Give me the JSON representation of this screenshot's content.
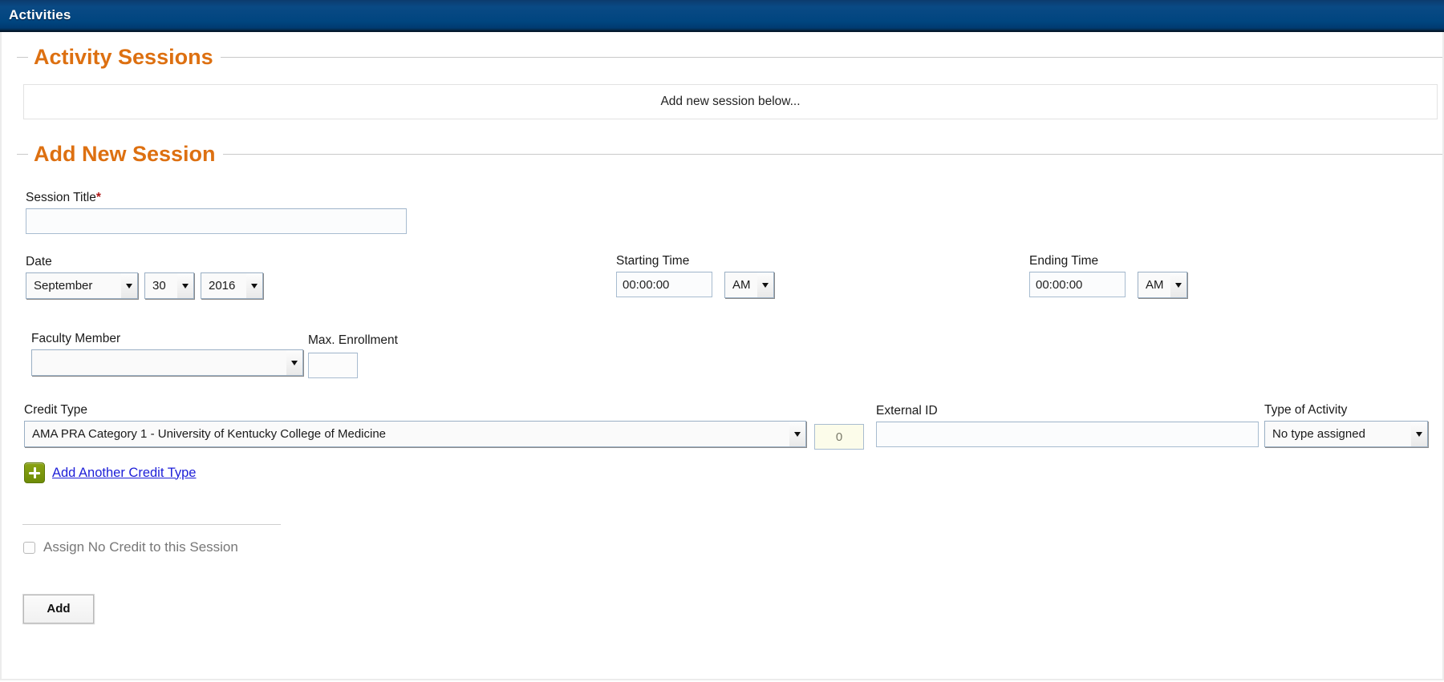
{
  "appbar": {
    "title": "Activities"
  },
  "sessions_group": {
    "legend": "Activity Sessions",
    "empty_message": "Add new session below..."
  },
  "add_session_group": {
    "legend": "Add New Session",
    "session_title": {
      "label": "Session Title",
      "required_marker": "*",
      "value": "",
      "placeholder": ""
    },
    "date": {
      "label": "Date",
      "month": "September",
      "day": "30",
      "year": "2016"
    },
    "starting_time": {
      "label": "Starting Time",
      "value": "00:00:00",
      "meridiem": "AM"
    },
    "ending_time": {
      "label": "Ending Time",
      "value": "00:00:00",
      "meridiem": "AM"
    },
    "faculty_member": {
      "label": "Faculty Member",
      "value": ""
    },
    "max_enrollment": {
      "label": "Max. Enrollment",
      "value": ""
    },
    "credit_type": {
      "label": "Credit Type",
      "value": "AMA PRA Category 1 - University of Kentucky College of Medicine",
      "amount": "0"
    },
    "external_id": {
      "label": "External ID",
      "value": ""
    },
    "type_of_activity": {
      "label": "Type of Activity",
      "value": "No type assigned"
    },
    "add_credit_type": {
      "icon": "plus-icon",
      "label": "Add Another Credit Type"
    },
    "no_credit": {
      "label": "Assign No Credit to this Session",
      "checked": false
    },
    "submit": {
      "label": "Add"
    }
  },
  "colors": {
    "appbar_blue": "#00457f",
    "legend_orange": "#dd7011",
    "link_blue": "#1f20d8",
    "required_red": "#b01818",
    "plus_green": "#7a9a0e",
    "credit_field_yellow": "#fcfcea"
  }
}
